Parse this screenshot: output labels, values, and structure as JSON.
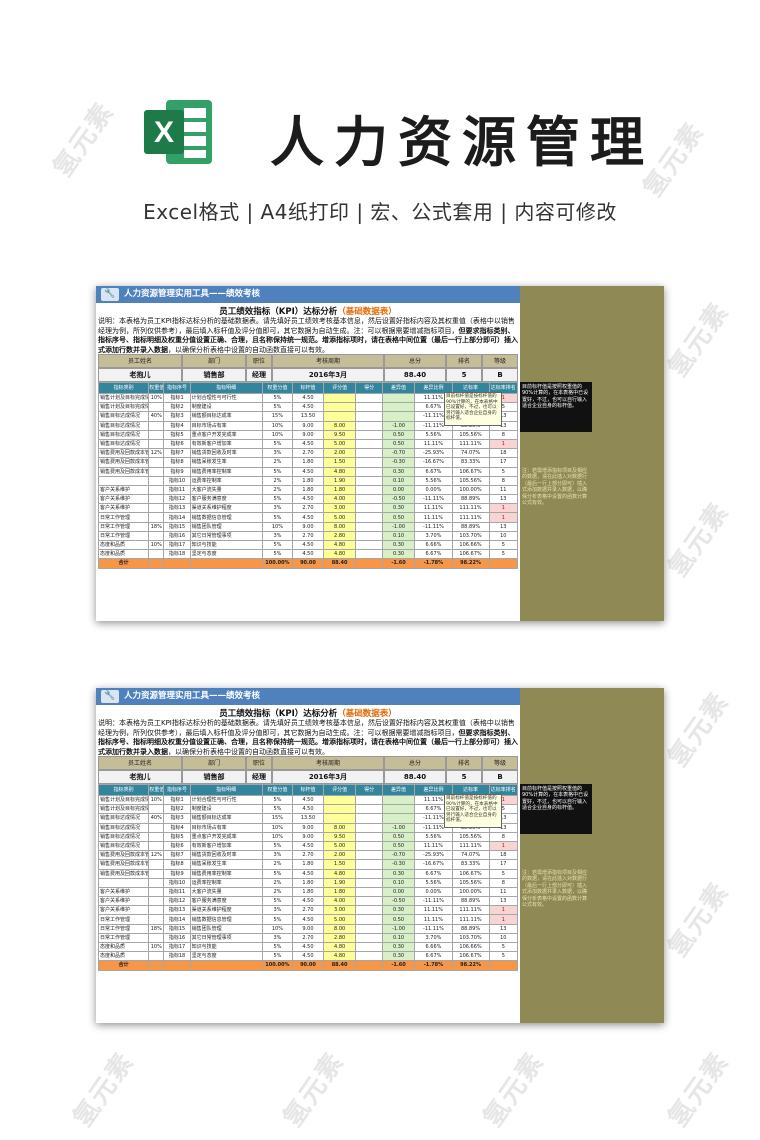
{
  "header": {
    "logo_letter": "X",
    "title": "人力资源管理",
    "subtitle": "Excel格式 |  A4纸打印 | 宏、公式套用 | 内容可修改"
  },
  "watermark": "氢元素",
  "sheet": {
    "bar_title": "人力资源管理实用工具——绩效考核",
    "report_title": "员工绩效指标（KPI）达标分析",
    "report_title_highlight": "（基础数据表）",
    "desc_1": "说明：本表格为员工KPI指标达标分析的基础数据表。请先填好员工绩效考核基本信息，然后设置好指标内容及其权重值（表格中以销售经理为例，所列仅供参考），最后填入标杆值及评分值即可，其它数据为自动生成。注：可以根据需要增减指标项目，",
    "desc_bold": "但要求指标类别、指标序号、指标明细及权重分值设置正确、合理，且名称保持统一规范。增添指标项时，请在表格中间位置（最后一行上部分即可）插入式添加行数并录入数据",
    "desc_2": "，以确保分析表格中设置的自动函数直接可以有效。",
    "info_head": [
      "员工姓名",
      "部门",
      "职位",
      "考核周期",
      "总分",
      "排名",
      "等级"
    ],
    "info_vals": [
      "老抱儿",
      "销售部",
      "经理",
      "2016年3月",
      "88.40",
      "5",
      "B"
    ],
    "columns": [
      "指标类别",
      "权重值",
      "指标序号",
      "指标明细",
      "权重分值",
      "标杆值",
      "评分值",
      "得分",
      "差异值",
      "差异比例",
      "达标率",
      "达标率排名"
    ],
    "rows": [
      [
        "销售计划及目标完成情况",
        "10%",
        "指标1",
        "计划合理性与可行性",
        "5%",
        "4.50",
        "",
        "",
        "",
        "11.11%",
        "111.11%",
        "1"
      ],
      [
        "销售计划及目标完成情况",
        "",
        "指标2",
        "制度建设",
        "5%",
        "4.50",
        "",
        "",
        "",
        "6.67%",
        "106.67%",
        "5"
      ],
      [
        "销售目标达成情况",
        "40%",
        "指标3",
        "销售额目标达成率",
        "15%",
        "13.50",
        "",
        "",
        "",
        "-11.11%",
        "88.89%",
        "13"
      ],
      [
        "销售目标达成情况",
        "",
        "指标4",
        "目标市场占有率",
        "10%",
        "9.00",
        "8.00",
        "",
        "-1.00",
        "-11.11%",
        "88.89%",
        "13"
      ],
      [
        "销售目标达成情况",
        "",
        "指标5",
        "重点客户开发完成率",
        "10%",
        "9.00",
        "9.50",
        "",
        "0.50",
        "5.56%",
        "105.56%",
        "8"
      ],
      [
        "销售目标达成情况",
        "",
        "指标6",
        "有效新客户增加率",
        "5%",
        "4.50",
        "5.00",
        "",
        "0.50",
        "11.11%",
        "111.11%",
        "1"
      ],
      [
        "销售费用及回款成本管理控制",
        "12%",
        "指标7",
        "销售货款回收及时率",
        "3%",
        "2.70",
        "2.00",
        "",
        "-0.70",
        "-25.93%",
        "74.07%",
        "18"
      ],
      [
        "销售费用及回款成本管理控制",
        "",
        "指标8",
        "销售呆账发生率",
        "2%",
        "1.80",
        "1.50",
        "",
        "-0.30",
        "-16.67%",
        "83.33%",
        "17"
      ],
      [
        "销售费用及回款成本管理控制",
        "",
        "指标9",
        "销售费用率控制率",
        "5%",
        "4.50",
        "4.80",
        "",
        "0.30",
        "6.67%",
        "106.67%",
        "5"
      ],
      [
        "",
        "",
        "指标10",
        "运费率控制率",
        "2%",
        "1.80",
        "1.90",
        "",
        "0.10",
        "5.56%",
        "105.56%",
        "8"
      ],
      [
        "客户关系维护",
        "",
        "指标11",
        "大客户流失量",
        "2%",
        "1.80",
        "1.80",
        "",
        "0.00",
        "0.00%",
        "100.00%",
        "11"
      ],
      [
        "客户关系维护",
        "",
        "指标12",
        "客户服务满意度",
        "5%",
        "4.50",
        "4.00",
        "",
        "-0.50",
        "-11.11%",
        "88.89%",
        "13"
      ],
      [
        "客户关系维护",
        "",
        "指标13",
        "渠道关系维护程度",
        "3%",
        "2.70",
        "3.00",
        "",
        "0.30",
        "11.11%",
        "111.11%",
        "1"
      ],
      [
        "日常工作管理",
        "",
        "指标14",
        "销售数据信息管理",
        "5%",
        "4.50",
        "5.00",
        "",
        "0.50",
        "11.11%",
        "111.11%",
        "1"
      ],
      [
        "日常工作管理",
        "18%",
        "指标15",
        "销售团队管理",
        "10%",
        "9.00",
        "8.00",
        "",
        "-1.00",
        "-11.11%",
        "88.89%",
        "13"
      ],
      [
        "日常工作管理",
        "",
        "指标16",
        "其它日常管理事项",
        "3%",
        "2.70",
        "2.80",
        "",
        "0.10",
        "3.70%",
        "103.70%",
        "10"
      ],
      [
        "态度和品质",
        "10%",
        "指标17",
        "知识与技能",
        "5%",
        "4.50",
        "4.80",
        "",
        "0.30",
        "6.66%",
        "106.66%",
        "5"
      ],
      [
        "态度和品质",
        "",
        "指标18",
        "坚定与态度",
        "5%",
        "4.50",
        "4.80",
        "",
        "0.30",
        "6.67%",
        "106.67%",
        "5"
      ]
    ],
    "total": [
      "合计",
      "",
      "",
      "",
      "100.00%",
      "90.00",
      "88.40",
      "",
      "-1.60",
      "-1.78%",
      "98.22%",
      ""
    ],
    "note": "目前标杆值是按标杆值的90%计算的，在本表格中已设置好，不过，也可以另行输入适合企业自身的标杆值。",
    "tip1": "目前标杆值是按照权重值的90%计算的，在本表格中已设置好，不过，也可以自行输入适合企业自身的标杆值。",
    "tip2": "注：若需增添指标项目及相应的数据，请在此插入对数据行（最后一行上部分即可）插入式添加数据并录入数据，以确保分析表格中设置的函数计算公式有效。"
  }
}
